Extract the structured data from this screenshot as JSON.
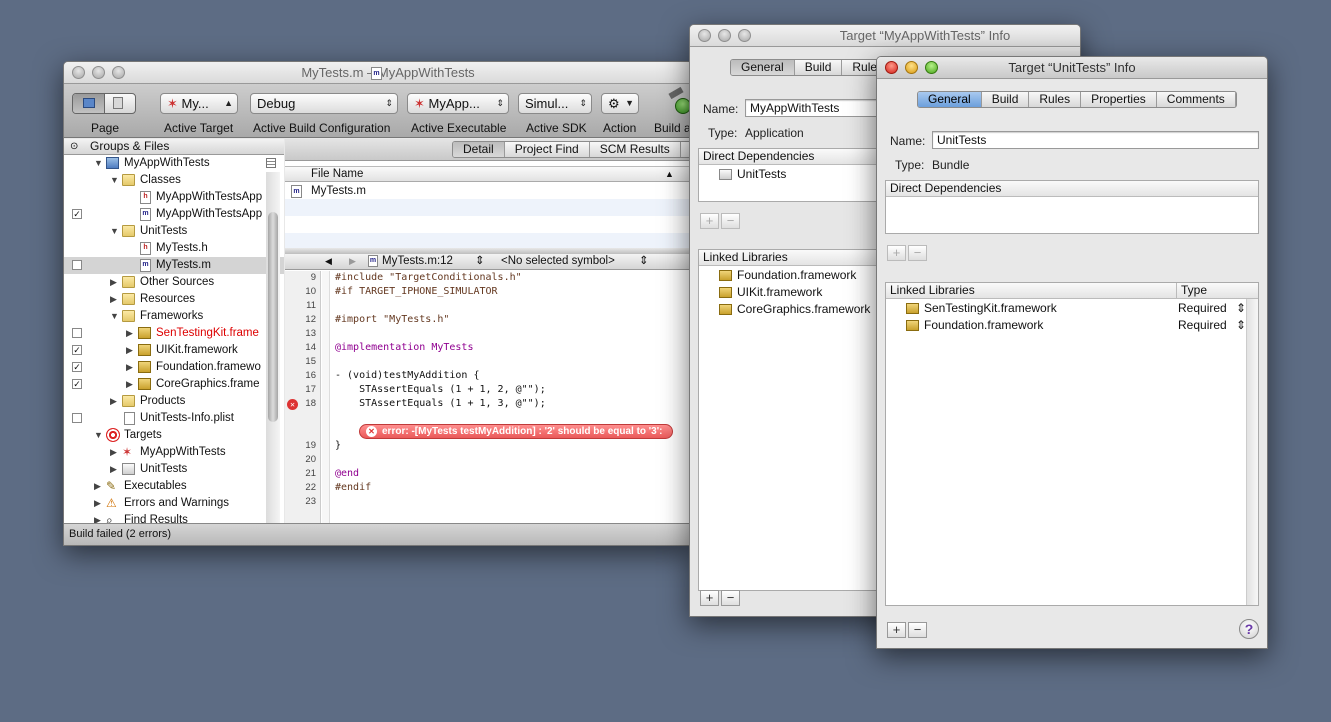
{
  "main_window": {
    "title": "MyTests.m – MyAppWithTests",
    "toolbar": {
      "page_label": "Page",
      "target_value": "My...",
      "target_label": "Active Target",
      "config_value": "Debug",
      "config_label": "Active Build Configuration",
      "exec_value": "MyApp...",
      "exec_label": "Active Executable",
      "sdk_value": "Simul...",
      "sdk_label": "Active SDK",
      "action_label": "Action",
      "build_label": "Build a"
    },
    "groups_header": "Groups & Files",
    "tree": [
      {
        "label": "MyAppWithTests"
      },
      {
        "label": "Classes"
      },
      {
        "label": "MyAppWithTestsApp"
      },
      {
        "label": "MyAppWithTestsApp"
      },
      {
        "label": "UnitTests"
      },
      {
        "label": "MyTests.h"
      },
      {
        "label": "MyTests.m"
      },
      {
        "label": "Other Sources"
      },
      {
        "label": "Resources"
      },
      {
        "label": "Frameworks"
      },
      {
        "label": "SenTestingKit.frame"
      },
      {
        "label": "UIKit.framework"
      },
      {
        "label": "Foundation.framewo"
      },
      {
        "label": "CoreGraphics.frame"
      },
      {
        "label": "Products"
      },
      {
        "label": "UnitTests-Info.plist"
      },
      {
        "label": "Targets"
      },
      {
        "label": "MyAppWithTests"
      },
      {
        "label": "UnitTests"
      },
      {
        "label": "Executables"
      },
      {
        "label": "Errors and Warnings"
      },
      {
        "label": "Find Results"
      }
    ],
    "tabs": [
      "Detail",
      "Project Find",
      "SCM Results",
      "Bu"
    ],
    "file_column": "File Name",
    "file_row": "MyTests.m",
    "nav": {
      "file": "MyTests.m:12",
      "symbol": "<No selected symbol>"
    },
    "code": [
      {
        "n": "9",
        "text": "#include \"TargetConditionals.h\""
      },
      {
        "n": "10",
        "text": "#if TARGET_IPHONE_SIMULATOR"
      },
      {
        "n": "11",
        "text": ""
      },
      {
        "n": "12",
        "text": "#import \"MyTests.h\""
      },
      {
        "n": "13",
        "text": ""
      },
      {
        "n": "14",
        "text": "@implementation MyTests"
      },
      {
        "n": "15",
        "text": ""
      },
      {
        "n": "16",
        "text": "- (void)testMyAddition {"
      },
      {
        "n": "17",
        "text": "    STAssertEquals (1 + 1, 2, @\"\");"
      },
      {
        "n": "18",
        "text": "    STAssertEquals (1 + 1, 3, @\"\");"
      },
      {
        "n": "19",
        "text": "}"
      },
      {
        "n": "20",
        "text": ""
      },
      {
        "n": "21",
        "text": "@end"
      },
      {
        "n": "22",
        "text": "#endif"
      },
      {
        "n": "23",
        "text": ""
      }
    ],
    "error_message": "error: -[MyTests testMyAddition] : '2' should be equal to '3':",
    "status": "Build failed (2 errors)"
  },
  "app_info": {
    "title": "Target “MyAppWithTests” Info",
    "tabs": [
      "General",
      "Build",
      "Rules"
    ],
    "name_label": "Name:",
    "name_value": "MyAppWithTests",
    "type_label": "Type:",
    "type_value": "Application",
    "deps_header": "Direct Dependencies",
    "deps": [
      "UnitTests"
    ],
    "libs_header": "Linked Libraries",
    "libs": [
      "Foundation.framework",
      "UIKit.framework",
      "CoreGraphics.framework"
    ]
  },
  "unit_info": {
    "title": "Target “UnitTests” Info",
    "tabs": [
      "General",
      "Build",
      "Rules",
      "Properties",
      "Comments"
    ],
    "name_label": "Name:",
    "name_value": "UnitTests",
    "type_label": "Type:",
    "type_value": "Bundle",
    "deps_header": "Direct Dependencies",
    "libs_header": "Linked Libraries",
    "type_col": "Type",
    "libs": [
      {
        "name": "SenTestingKit.framework",
        "type": "Required"
      },
      {
        "name": "Foundation.framework",
        "type": "Required"
      }
    ],
    "help": "?"
  },
  "symbols": {
    "plus": "+",
    "minus": "−",
    "check": "✓",
    "down": "▼",
    "right": "▶",
    "updown": "⇕"
  }
}
